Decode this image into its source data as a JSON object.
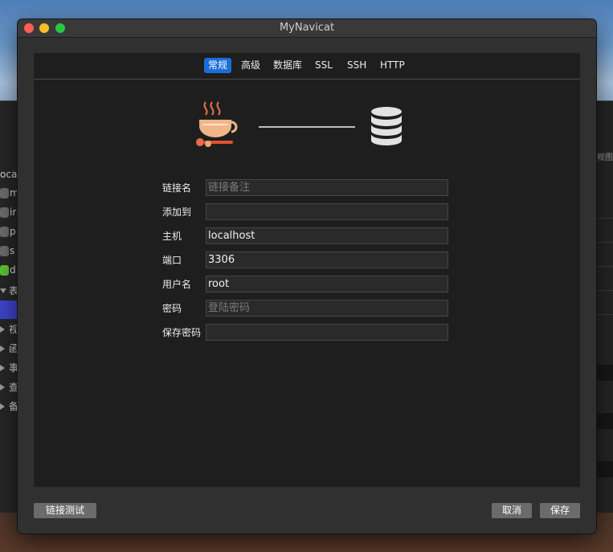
{
  "window": {
    "title": "MyNavicat"
  },
  "tabs": [
    {
      "label": "常规",
      "active": true
    },
    {
      "label": "高级",
      "active": false
    },
    {
      "label": "数据库",
      "active": false
    },
    {
      "label": "SSL",
      "active": false
    },
    {
      "label": "SSH",
      "active": false
    },
    {
      "label": "HTTP",
      "active": false
    }
  ],
  "hero": {
    "left_icon": "coffee-cup-icon",
    "right_icon": "database-icon"
  },
  "form": {
    "name": {
      "label": "链接名",
      "value": "",
      "placeholder": "链接备注"
    },
    "add_to": {
      "label": "添加到",
      "value": "",
      "placeholder": ""
    },
    "host": {
      "label": "主机",
      "value": "localhost",
      "placeholder": ""
    },
    "port": {
      "label": "端口",
      "value": "3306",
      "placeholder": ""
    },
    "user": {
      "label": "用户名",
      "value": "root",
      "placeholder": ""
    },
    "password": {
      "label": "密码",
      "value": "",
      "placeholder": "登陆密码"
    },
    "save_password": {
      "label": "保存密码",
      "value": "",
      "placeholder": ""
    }
  },
  "buttons": {
    "test": "链接测试",
    "cancel": "取消",
    "save": "保存"
  },
  "background_window": {
    "header_fragment": "ocal",
    "right_fragment": "视图",
    "items": [
      "m",
      "ir",
      "p",
      "s",
      "d",
      "表",
      "视",
      "函",
      "事",
      "查",
      "备"
    ]
  },
  "colors": {
    "accent": "#1a6ed8",
    "close": "#fd5f57",
    "minimize": "#febc2e",
    "maximize": "#29c840",
    "status_green": "#5bc236"
  }
}
